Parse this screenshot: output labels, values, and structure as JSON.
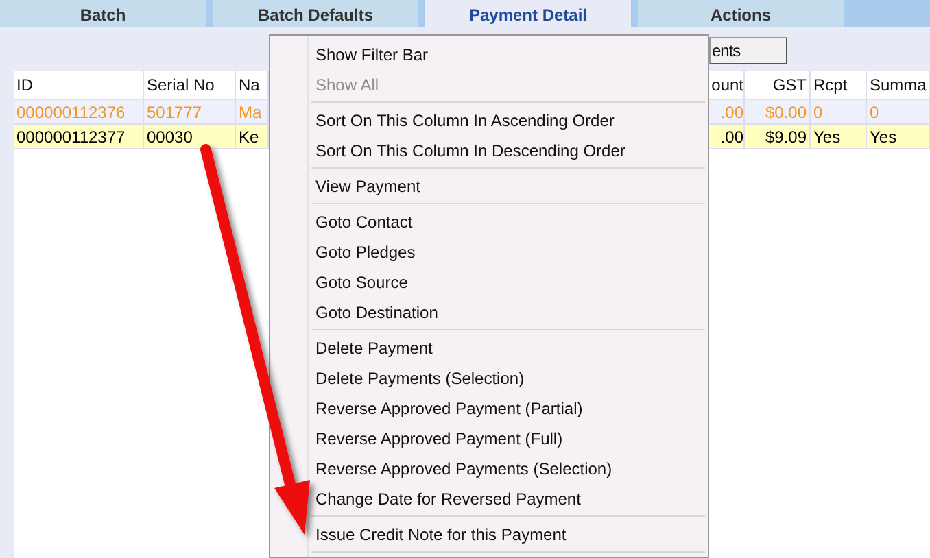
{
  "tabs": [
    {
      "label": "Batch",
      "selected": false
    },
    {
      "label": "Batch Defaults",
      "selected": false
    },
    {
      "label": "Payment Detail",
      "selected": true
    },
    {
      "label": "Actions",
      "selected": false
    }
  ],
  "toolbar": {
    "button": "ents"
  },
  "table": {
    "columns": [
      "ID",
      "Serial No",
      "Na",
      "ount",
      "GST",
      "Rcpt",
      "Summa"
    ],
    "rows": [
      {
        "cells": [
          "000000112376",
          "501777",
          "Ma",
          ".00",
          "$0.00",
          "0",
          "0"
        ],
        "color": "#f7941d",
        "highlighted": false
      },
      {
        "cells": [
          "000000112377",
          "00030",
          "Ke",
          ".00",
          "$9.09",
          "Yes",
          "Yes"
        ],
        "color": "#000000",
        "highlighted": true
      }
    ]
  },
  "context_menu": {
    "items": [
      {
        "kind": "item",
        "label": "Show Filter Bar",
        "disabled": false
      },
      {
        "kind": "item",
        "label": "Show All",
        "disabled": true
      },
      {
        "kind": "separator"
      },
      {
        "kind": "item",
        "label": "Sort On This Column In Ascending Order",
        "disabled": false
      },
      {
        "kind": "item",
        "label": "Sort On This Column In Descending Order",
        "disabled": false
      },
      {
        "kind": "separator"
      },
      {
        "kind": "item",
        "label": "View Payment",
        "disabled": false
      },
      {
        "kind": "separator"
      },
      {
        "kind": "item",
        "label": "Goto Contact",
        "disabled": false
      },
      {
        "kind": "item",
        "label": "Goto Pledges",
        "disabled": false
      },
      {
        "kind": "item",
        "label": "Goto Source",
        "disabled": false
      },
      {
        "kind": "item",
        "label": "Goto Destination",
        "disabled": false
      },
      {
        "kind": "separator"
      },
      {
        "kind": "item",
        "label": "Delete Payment",
        "disabled": false
      },
      {
        "kind": "item",
        "label": "Delete Payments (Selection)",
        "disabled": false
      },
      {
        "kind": "item",
        "label": "Reverse Approved Payment (Partial)",
        "disabled": false
      },
      {
        "kind": "item",
        "label": "Reverse Approved Payment (Full)",
        "disabled": false
      },
      {
        "kind": "item",
        "label": "Reverse Approved Payments (Selection)",
        "disabled": false
      },
      {
        "kind": "item",
        "label": "Change Date for Reversed Payment",
        "disabled": false
      },
      {
        "kind": "separator"
      },
      {
        "kind": "item",
        "label": "Issue Credit Note for this Payment",
        "disabled": false
      },
      {
        "kind": "separator"
      }
    ]
  }
}
